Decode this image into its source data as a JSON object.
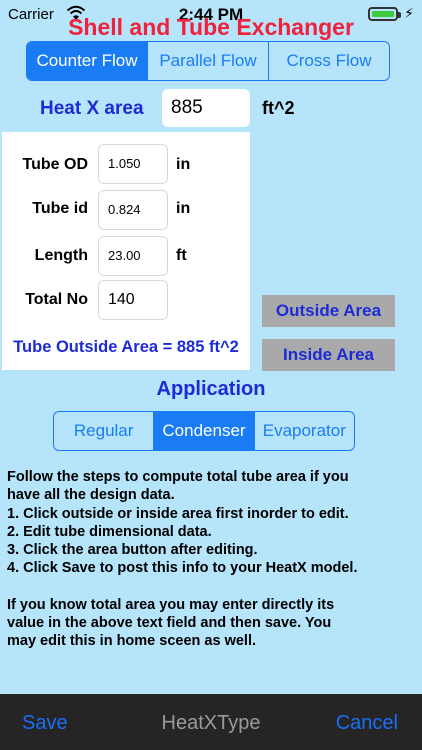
{
  "status_bar": {
    "carrier": "Carrier",
    "time": "2:44 PM",
    "wifi_icon": "wifi-icon",
    "battery_icon": "battery-icon",
    "charging_icon": "bolt-icon",
    "bolt": "⚡"
  },
  "title": "Shell and Tube Exchanger",
  "flow_segment": {
    "options": [
      "Counter Flow",
      "Parallel Flow",
      "Cross Flow"
    ],
    "selected": "Counter Flow"
  },
  "heat_area": {
    "label": "Heat X area",
    "value": "885",
    "unit": "ft^2"
  },
  "tube": {
    "od": {
      "label": "Tube OD",
      "value": "1.050",
      "unit": "in"
    },
    "id": {
      "label": "Tube id",
      "value": "0.824",
      "unit": "in"
    },
    "length": {
      "label": "Length",
      "value": "23.00",
      "unit": "ft"
    },
    "total": {
      "label": "Total No",
      "value": "140"
    },
    "outside_area_text": "Tube Outside Area = 885 ft^2"
  },
  "buttons": {
    "outside_area": "Outside Area",
    "inside_area": "Inside Area"
  },
  "application": {
    "label": "Application",
    "options": [
      "Regular",
      "Condenser",
      "Evaporator"
    ],
    "selected": "Condenser"
  },
  "instructions": {
    "lines": [
      "Follow the steps to compute total tube area if you",
      "have all the design data.",
      "1. Click outside or inside area first inorder to edit.",
      "2. Edit tube dimensional data.",
      "3. Click the area button after editing.",
      "4. Click Save to post this info to your HeatX model."
    ],
    "lines2": [
      "If you know total area you may enter directly its",
      "value in the above text field and then save.  You",
      "may edit this in home sceen as well."
    ]
  },
  "toolbar": {
    "save": "Save",
    "title": "HeatXType",
    "cancel": "Cancel"
  },
  "colors": {
    "background": "#b6e4fa",
    "accent": "#1a7cf5",
    "title": "#f0213a",
    "label_blue": "#1d2bd6",
    "button_gray": "#a9a9a9",
    "toolbar": "#252525"
  }
}
